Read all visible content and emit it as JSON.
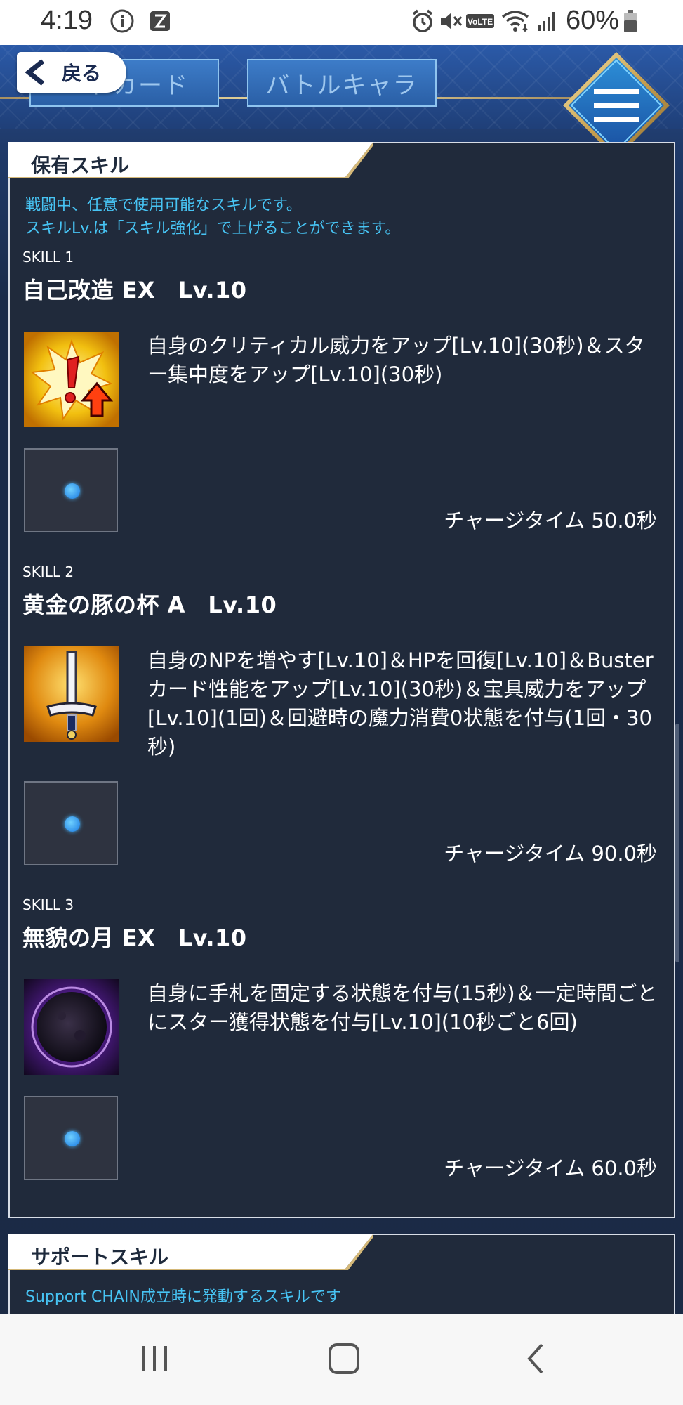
{
  "status_bar": {
    "time": "4:19",
    "battery_percent": "60%",
    "icons": [
      "info-icon",
      "nfc-icon",
      "alarm-icon",
      "mute-icon",
      "volte-icon",
      "wifi-icon",
      "signal-icon",
      "battery-icon"
    ]
  },
  "header": {
    "back_label": "戻る",
    "tabs": [
      {
        "label": "ドカード"
      },
      {
        "label": "バトルキャラ"
      }
    ],
    "menu_icon": "hamburger-menu-icon"
  },
  "owned_skills": {
    "title": "保有スキル",
    "description_lines": [
      "戦闘中、任意で使用可能なスキルです。",
      "スキルLv.は「スキル強化」で上げることができます。"
    ],
    "skills": [
      {
        "number": "SKILL 1",
        "name": "自己改造 EX　Lv.10",
        "icon": "critical-up-icon",
        "description": "自身のクリティカル威力をアップ[Lv.10](30秒)＆スター集中度をアップ[Lv.10](30秒)",
        "charge_time": "チャージタイム 50.0秒"
      },
      {
        "number": "SKILL 2",
        "name": "黄金の豚の杯 A　Lv.10",
        "icon": "sword-buster-icon",
        "description": "自身のNPを増やす[Lv.10]＆HPを回復[Lv.10]＆Busterカード性能をアップ[Lv.10](30秒)＆宝具威力をアップ[Lv.10](1回)＆回避時の魔力消費0状態を付与(1回・30秒)",
        "charge_time": "チャージタイム 90.0秒"
      },
      {
        "number": "SKILL 3",
        "name": "無貌の月 EX　Lv.10",
        "icon": "dark-moon-icon",
        "description": "自身に手札を固定する状態を付与(15秒)＆一定時間ごとにスター獲得状態を付与[Lv.10](10秒ごと6回)",
        "charge_time": "チャージタイム 60.0秒"
      }
    ]
  },
  "support_skills": {
    "title": "サポートスキル",
    "description": "Support CHAIN成立時に発動するスキルです"
  },
  "colors": {
    "accent_text": "#47c4f4",
    "panel_bg": "#202a3b",
    "gold": "#d4b878"
  }
}
